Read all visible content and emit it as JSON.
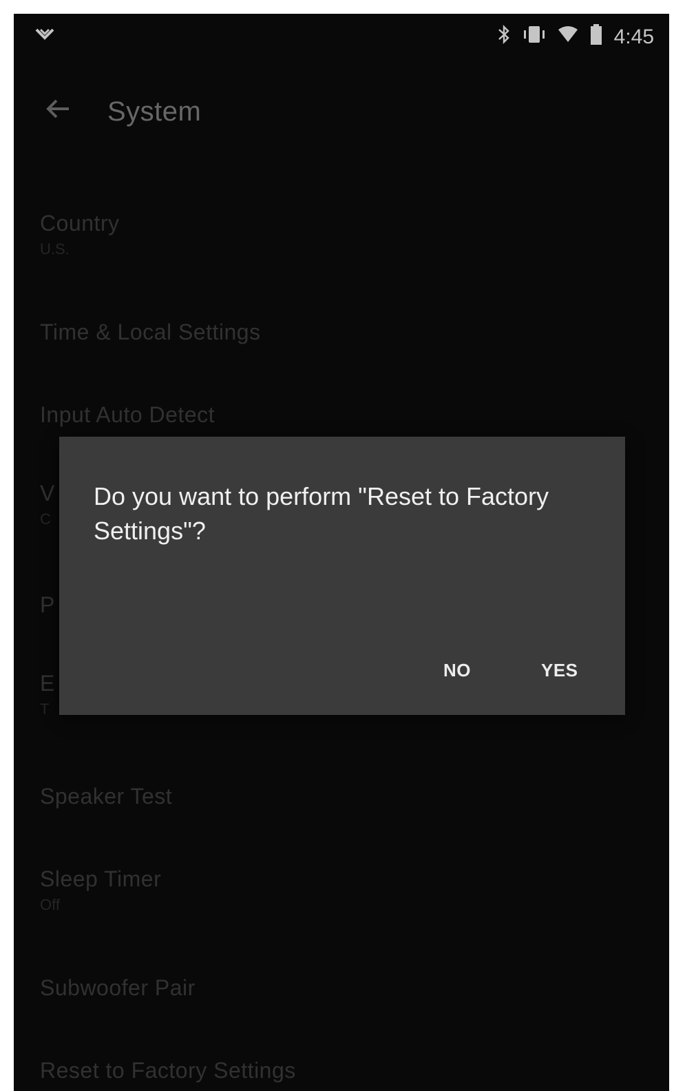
{
  "status_bar": {
    "time": "4:45",
    "icons": [
      "notification-chevron-icon",
      "bluetooth-icon",
      "vibrate-icon",
      "wifi-icon",
      "battery-icon"
    ]
  },
  "app_bar": {
    "title": "System"
  },
  "settings": {
    "items": [
      {
        "label": "Country",
        "sub": "U.S."
      },
      {
        "label": "Time & Local Settings",
        "sub": ""
      },
      {
        "label": "Input Auto Detect",
        "sub": ""
      },
      {
        "label": "V",
        "sub": "C"
      },
      {
        "label": "P",
        "sub": ""
      },
      {
        "label": "E",
        "sub": "T"
      },
      {
        "label": "Speaker Test",
        "sub": ""
      },
      {
        "label": "Sleep Timer",
        "sub": "Off"
      },
      {
        "label": "Subwoofer Pair",
        "sub": ""
      },
      {
        "label": "Reset to Factory Settings",
        "sub": ""
      }
    ]
  },
  "dialog": {
    "message": "Do you want to perform \"Reset to Factory Settings\"?",
    "no_label": "NO",
    "yes_label": "YES"
  },
  "colors": {
    "background": "#0b0b0b",
    "dialog_background": "#3b3b3b",
    "dialog_text": "#f0f0f0",
    "list_text": "#3a3a3a"
  }
}
